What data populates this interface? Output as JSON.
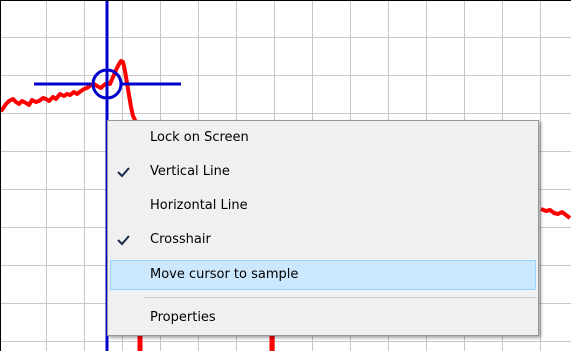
{
  "plot": {
    "background": "#ffffff",
    "grid_color": "#c8c8c8",
    "trace_color": "#ff0000",
    "cursor_color": "#0000cc",
    "border_color": "#000000"
  },
  "cursor": {
    "marker_icon": "circle-crosshair-icon",
    "vertical_line": true,
    "horizontal_line": false,
    "crosshair": true
  },
  "context_menu": {
    "items": [
      {
        "label": "Lock on Screen",
        "checked": false,
        "highlighted": false
      },
      {
        "label": "Vertical Line",
        "checked": true,
        "highlighted": false
      },
      {
        "label": "Horizontal Line",
        "checked": false,
        "highlighted": false
      },
      {
        "label": "Crosshair",
        "checked": true,
        "highlighted": false
      },
      {
        "label": "Move cursor to sample",
        "checked": false,
        "highlighted": true
      },
      {
        "label": "Properties",
        "checked": false,
        "highlighted": false
      }
    ],
    "check_icon": "checkmark-icon",
    "colors": {
      "menu_bg": "#f0f0f0",
      "highlight_bg": "#cce8ff",
      "highlight_border": "#99d1ff",
      "check_color": "#1a2a4a"
    }
  }
}
